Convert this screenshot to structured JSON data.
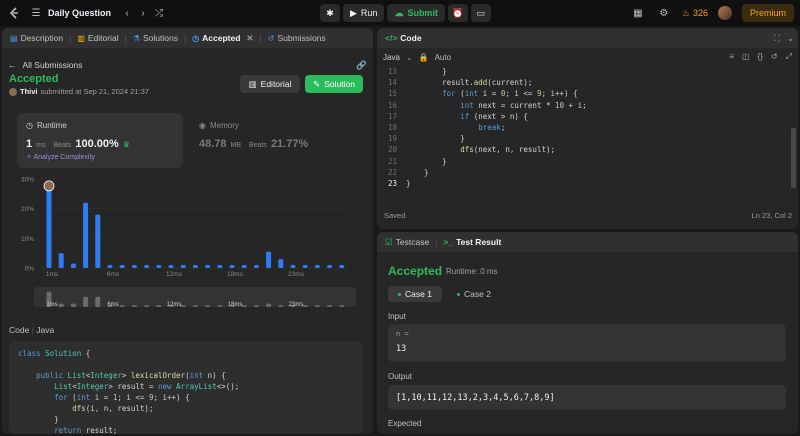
{
  "topbar": {
    "problem_title": "Daily Question",
    "run_label": "Run",
    "submit_label": "Submit",
    "streak_count": "326",
    "premium_label": "Premium"
  },
  "left_tabs": [
    {
      "label": "Description"
    },
    {
      "label": "Editorial"
    },
    {
      "label": "Solutions"
    },
    {
      "label": "Accepted"
    },
    {
      "label": "Submissions"
    }
  ],
  "submission": {
    "back_label": "All Submissions",
    "status": "Accepted",
    "user": "Thivi",
    "submitted_text": "submitted at Sep 21, 2024 21:37",
    "editorial_btn": "Editorial",
    "solution_btn": "Solution",
    "runtime": {
      "label": "Runtime",
      "value": "1",
      "unit": "ms",
      "beats_label": "Beats",
      "beats": "100.00%",
      "analyze": "Analyze Complexity"
    },
    "memory": {
      "label": "Memory",
      "value": "48.78",
      "unit": "MB",
      "beats_label": "Beats",
      "beats": "21.77%"
    }
  },
  "chart_data": {
    "type": "bar",
    "y_ticks": [
      "30%",
      "20%",
      "10%",
      "0%"
    ],
    "ylim": [
      0,
      30
    ],
    "x_tick_labels": [
      "1ms",
      "6ms",
      "12ms",
      "18ms",
      "23ms"
    ],
    "values": [
      27,
      5,
      1.5,
      22,
      18,
      1,
      1,
      1,
      1,
      1,
      1,
      1,
      1,
      1,
      1,
      1,
      1,
      1,
      5.5,
      3,
      1,
      1,
      1,
      1,
      1
    ],
    "highlight_index": 0,
    "mini_values": [
      9,
      2,
      2,
      6,
      6,
      1,
      1,
      1,
      1,
      1,
      1,
      1,
      1,
      1,
      1,
      1,
      1,
      1,
      2,
      1,
      1,
      1,
      1,
      1,
      1
    ],
    "colors": {
      "bar": "#2f7cf6",
      "mini": "#6a6a6a"
    }
  },
  "code_section": {
    "label": "Code",
    "lang": "Java",
    "lines": [
      "class Solution {",
      "",
      "    public List<Integer> lexicalOrder(int n) {",
      "        List<Integer> result = new ArrayList<>();",
      "        for (int i = 1; i <= 9; i++) {",
      "            dfs(i, n, result);",
      "        }",
      "        return result;"
    ]
  },
  "editor": {
    "title": "Code",
    "language": "Java",
    "mode": "Auto",
    "status": "Saved",
    "cursor": "Ln 23, Col 2",
    "line_numbers": [
      "13",
      "14",
      "15",
      "16",
      "17",
      "18",
      "19",
      "20",
      "21",
      "22",
      "23"
    ],
    "lines": [
      "        }",
      "        result.add(current);",
      "        for (int i = 0; i <= 9; i++) {",
      "            int next = current * 10 + i;",
      "            if (next > n) {",
      "                break;",
      "            }",
      "            dfs(next, n, result);",
      "        }",
      "    }",
      "}"
    ]
  },
  "result_panel": {
    "tab_testcase": "Testcase",
    "tab_result": "Test Result",
    "status": "Accepted",
    "runtime": "Runtime: 0 ms",
    "case1": "Case 1",
    "case2": "Case 2",
    "input_label": "Input",
    "input_var": "n =",
    "input_value": "13",
    "output_label": "Output",
    "output_value": "[1,10,11,12,13,2,3,4,5,6,7,8,9]",
    "expected_label": "Expected"
  }
}
